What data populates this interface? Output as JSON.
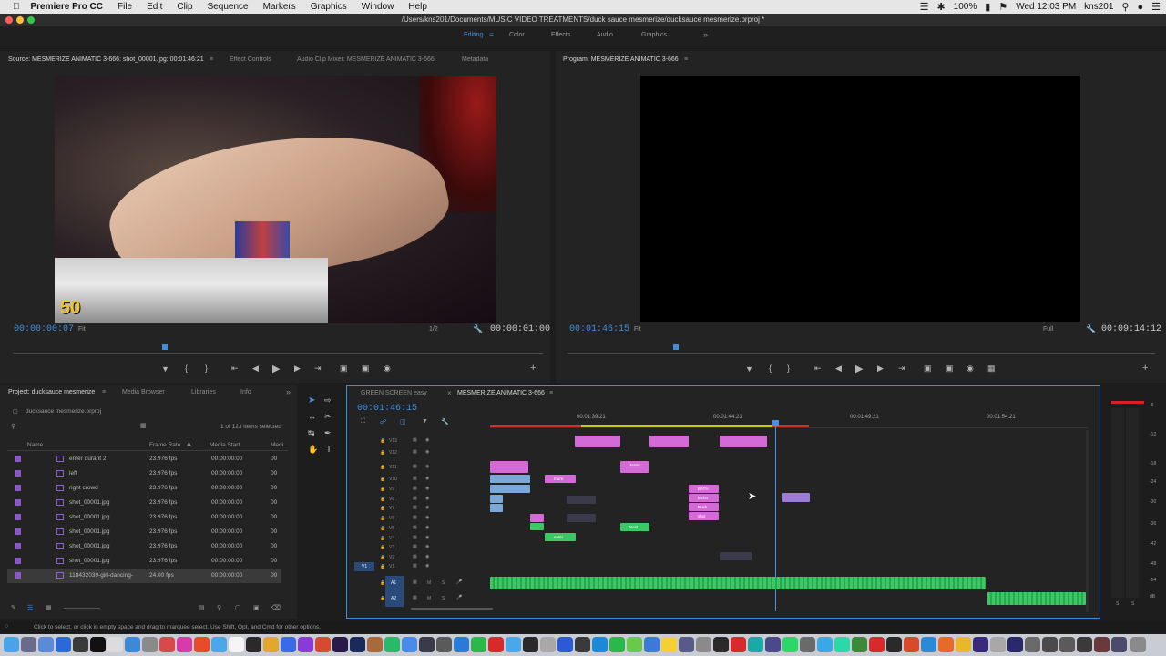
{
  "menubar": {
    "app_name": "Premiere Pro CC",
    "items": [
      "File",
      "Edit",
      "Clip",
      "Sequence",
      "Markers",
      "Graphics",
      "Window",
      "Help"
    ],
    "battery": "100%",
    "clock": "Wed 12:03 PM",
    "user": "kns201"
  },
  "title_path": "/Users/kns201/Documents/MUSIC VIDEO TREATMENTS/duck sauce mesmerize/ducksauce mesmerize.prproj *",
  "workspaces": [
    "Editing",
    "Color",
    "Effects",
    "Audio",
    "Graphics"
  ],
  "active_workspace": "Editing",
  "source_panel": {
    "tabs": [
      "Source: MESMERIZE ANIMATIC 3-666: shot_00001.jpg: 00:01:46:21",
      "Effect Controls",
      "Audio Clip Mixer: MESMERIZE ANIMATIC 3-666",
      "Metadata"
    ],
    "timecode_left": "00:00:00:07",
    "fit": "Fit",
    "resolution": "1/2",
    "timecode_right": "00:00:01:00",
    "overlay_number": "50"
  },
  "program_panel": {
    "tab": "Program: MESMERIZE ANIMATIC 3-666",
    "timecode_left": "00:01:46:15",
    "fit": "Fit",
    "quality": "Full",
    "timecode_right": "00:09:14:12"
  },
  "project_panel": {
    "tabs": [
      "Project: ducksauce mesmerize",
      "Media Browser",
      "Libraries",
      "Info"
    ],
    "project_file": "ducksauce mesmerize.prproj",
    "selection_info": "1 of 123 items selected",
    "columns": [
      "Name",
      "Frame Rate",
      "Media Start",
      "Medi"
    ],
    "rows": [
      {
        "name": "enter durant 2",
        "rate": "23.976 fps",
        "start": "00:00:00:00",
        "med": "00"
      },
      {
        "name": "left",
        "rate": "23.976 fps",
        "start": "00:00:00:00",
        "med": "00"
      },
      {
        "name": "right crowd",
        "rate": "23.976 fps",
        "start": "00:00:00:00",
        "med": "00"
      },
      {
        "name": "shot_00001.jpg",
        "rate": "23.976 fps",
        "start": "00:00:00:00",
        "med": "00"
      },
      {
        "name": "shot_00001.jpg",
        "rate": "23.976 fps",
        "start": "00:00:00:00",
        "med": "00"
      },
      {
        "name": "shot_00001.jpg",
        "rate": "23.976 fps",
        "start": "00:00:00:00",
        "med": "00"
      },
      {
        "name": "shot_00001.jpg",
        "rate": "23.976 fps",
        "start": "00:00:00:00",
        "med": "00"
      },
      {
        "name": "shot_00001.jpg",
        "rate": "23.976 fps",
        "start": "00:00:00:00",
        "med": "00"
      },
      {
        "name": "118432039-girl-dancing-",
        "rate": "24.00 fps",
        "start": "00:00:00:00",
        "med": "00"
      }
    ]
  },
  "timeline": {
    "tabs": [
      "GREEN SCREEN easy",
      "MESMERIZE ANIMATIC 3-666"
    ],
    "timecode": "00:01:46:15",
    "ruler": [
      "00:01:39:21",
      "00:01:44:21",
      "00:01:49:21",
      "00:01:54:21"
    ],
    "video_tracks": [
      "V13",
      "V12",
      "V11",
      "V10",
      "V9",
      "V8",
      "V7",
      "V6",
      "V5",
      "V4",
      "V3",
      "V2",
      "V1"
    ],
    "audio_tracks": [
      "A1",
      "A2"
    ],
    "clip_labels": [
      "Jesse",
      "more",
      "BATH",
      "techn",
      "Duck",
      "shot",
      "Nest",
      "enter"
    ]
  },
  "meter_scale": [
    "-6",
    "-12",
    "-18",
    "-24",
    "-30",
    "-36",
    "-42",
    "-48",
    "-54",
    "dB"
  ],
  "meter_bottom": [
    "S",
    "S"
  ],
  "status_bar": "Click to select, or click in empty space and drag to marquee select. Use Shift, Opt, and Cmd for other options."
}
